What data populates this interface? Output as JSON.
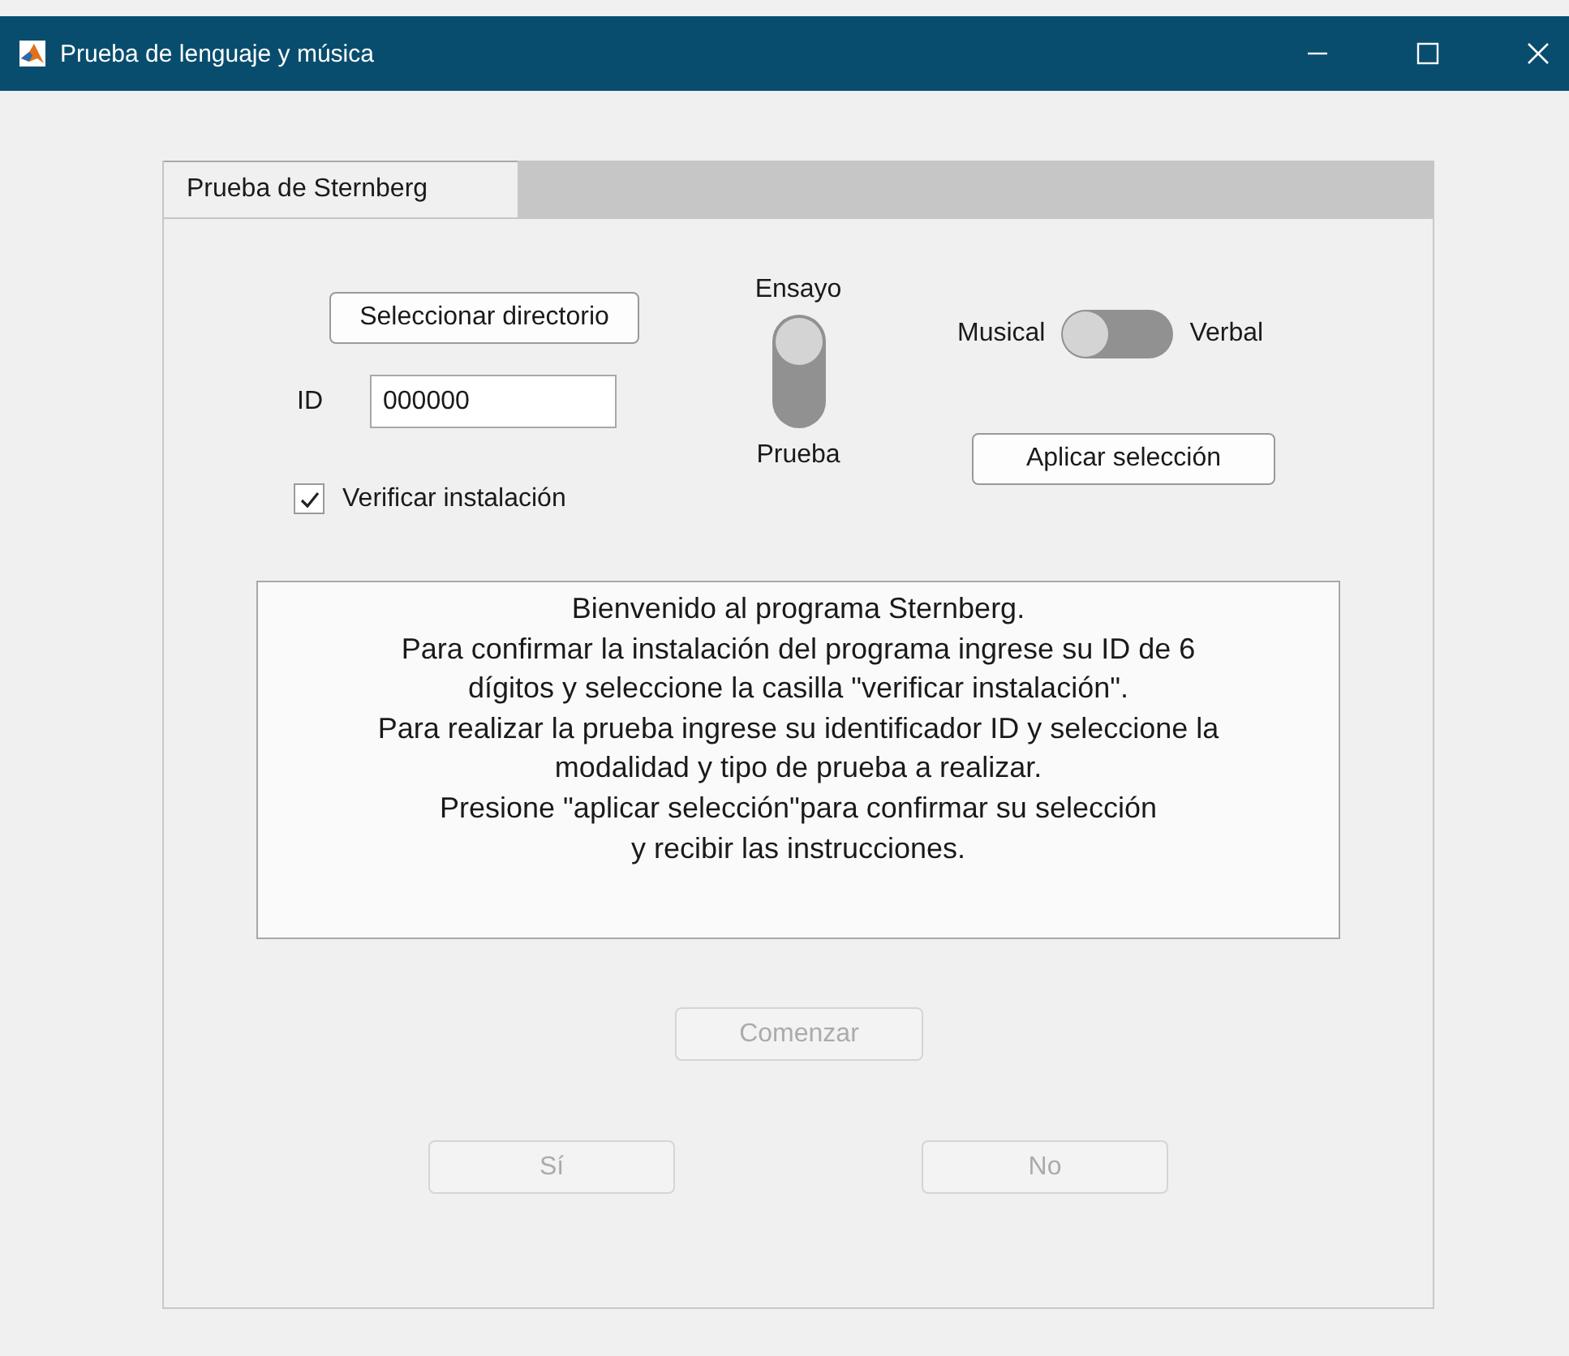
{
  "window": {
    "title": "Prueba de lenguaje y música"
  },
  "tabs": [
    {
      "label": "Prueba de Sternberg",
      "selected": true
    }
  ],
  "directory_button": {
    "label": "Seleccionar directorio",
    "disabled": false
  },
  "id_field": {
    "label": "ID",
    "value": "000000"
  },
  "verify_checkbox": {
    "label": "Verificar instalación",
    "checked": true
  },
  "test_switch": {
    "labels": [
      "Ensayo",
      "Prueba"
    ],
    "on": false
  },
  "mode_switch": {
    "labels": [
      "Musical",
      "Verbal"
    ],
    "on": false
  },
  "apply_button": {
    "label": "Aplicar selección",
    "disabled": false
  },
  "message": {
    "lines": [
      "Bienvenido al programa Sternberg.",
      "Para confirmar la instalación del programa ingrese su ID de 6",
      "dígitos y seleccione la casilla \"verificar instalación\".",
      "Para realizar la prueba ingrese su identificador ID y seleccione la",
      "modalidad y tipo de prueba a realizar.",
      "Presione \"aplicar selección\"para confirmar su selección",
      "y recibir las instrucciones."
    ]
  },
  "start_button": {
    "label": "Comenzar",
    "disabled": true
  },
  "answer_buttons": [
    {
      "label": "Sí",
      "disabled": true
    },
    {
      "label": "No",
      "disabled": true
    }
  ]
}
